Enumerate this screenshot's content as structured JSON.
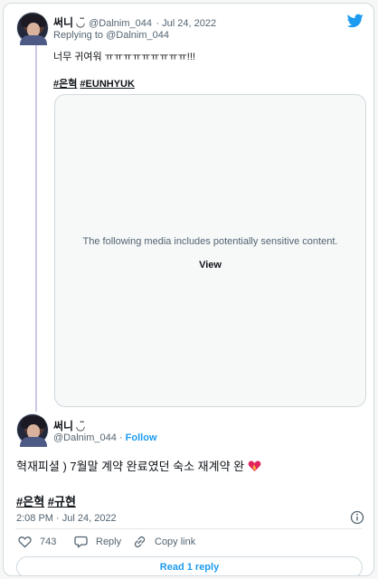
{
  "first_tweet": {
    "display_name": "써니 ◡̈",
    "handle": "@Dalnim_044",
    "date": "· Jul 24, 2022",
    "replying_to": "Replying to @Dalnim_044",
    "text": "너무 귀여워 ㅠㅠㅠㅠㅠㅠㅠㅠㅠ!!!",
    "hashtags": [
      "#은혁",
      "#EUNHYUK"
    ],
    "media_warning": "The following media includes potentially sensitive content.",
    "media_view_label": "View"
  },
  "main_tweet": {
    "display_name": "써니 ◡̈",
    "handle": "@Dalnim_044",
    "follow_label": "Follow",
    "text": "혁재피셜 ) 7월말 계약 완료였던 숙소 재계약 완",
    "hashtags": [
      "#은혁",
      "#규현"
    ],
    "timestamp": "2:08 PM · Jul 24, 2022",
    "like_count": "743",
    "reply_label": "Reply",
    "copy_link_label": "Copy link",
    "read_replies_label": "Read 1 reply"
  },
  "colors": {
    "brand_blue": "#1d9bf0",
    "heart_emoji": "#e0245e",
    "thread_line": "#cfc6e8"
  },
  "icons": [
    "twitter-bird-icon",
    "info-icon",
    "heart-icon",
    "reply-icon",
    "link-icon",
    "heart-on-fire-emoji"
  ]
}
